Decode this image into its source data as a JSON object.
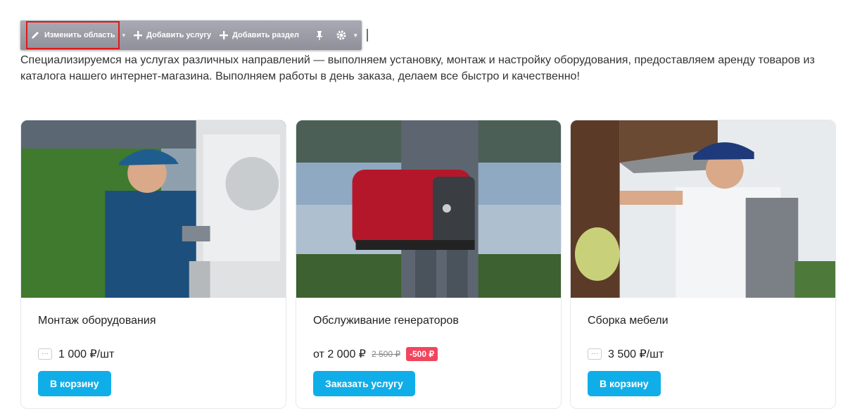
{
  "toolbar": {
    "edit_area_label": "Изменить область",
    "add_service_label": "Добавить услугу",
    "add_section_label": "Добавить раздел",
    "icons": [
      "pencil-icon",
      "chevron-down-icon",
      "plus-icon",
      "pin-icon",
      "gear-icon"
    ]
  },
  "description": "Специализируемся на услугах различных направлений — выполняем установку, монтаж и настройку оборудования, предоставляем аренду товаров из каталога нашего интернет-магазина. Выполняем работы в день заказа, делаем все быстро и качественно!",
  "cards": [
    {
      "title": "Монтаж оборудования",
      "dots": "···",
      "price": "1 000 ₽/шт",
      "button": "В корзину"
    },
    {
      "title": "Обслуживание генераторов",
      "price": "от 2 000 ₽",
      "old_price": "2 500 ₽",
      "discount": "-500 ₽",
      "button": "Заказать услугу"
    },
    {
      "title": "Сборка мебели",
      "dots": "···",
      "price": "3 500 ₽/шт",
      "button": "В корзину"
    }
  ],
  "colors": {
    "accent": "#10aee9",
    "discount": "#f2455d",
    "highlight_border": "#e21818"
  }
}
